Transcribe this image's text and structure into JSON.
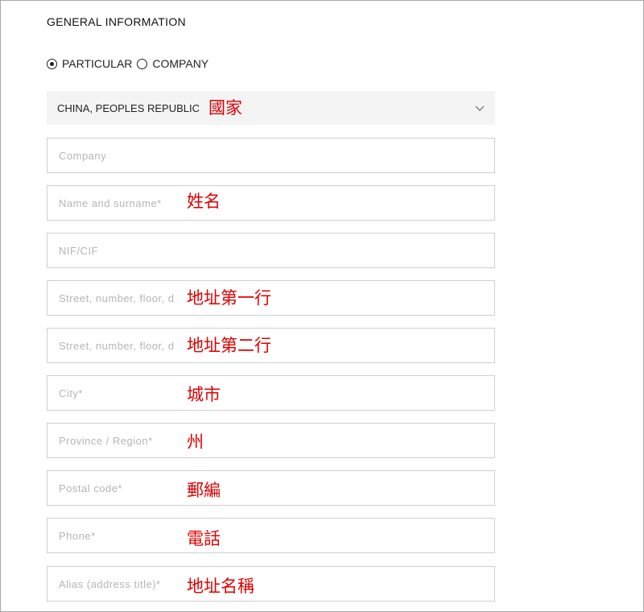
{
  "section_title": "GENERAL INFORMATION",
  "customer_type": {
    "options": [
      {
        "label": "PARTICULAR",
        "selected": true
      },
      {
        "label": "COMPANY",
        "selected": false
      }
    ]
  },
  "country": {
    "value": "CHINA, PEOPLES REPUBLIC",
    "annotation": "國家"
  },
  "fields": {
    "company": {
      "placeholder": "Company"
    },
    "name": {
      "placeholder": "Name and surname*",
      "annotation": "姓名"
    },
    "nif": {
      "placeholder": "NIF/CIF"
    },
    "street1": {
      "placeholder": "Street, number, floor, d",
      "annotation": "地址第一行"
    },
    "street2": {
      "placeholder": "Street, number, floor, d",
      "annotation": "地址第二行"
    },
    "city": {
      "placeholder": "City*",
      "annotation": "城市"
    },
    "province": {
      "placeholder": "Province / Region*",
      "annotation": "州"
    },
    "postal": {
      "placeholder": "Postal code*",
      "annotation": "郵編"
    },
    "phone": {
      "placeholder": "Phone*",
      "annotation": "電話"
    },
    "alias": {
      "placeholder": "Alias (address title)*",
      "annotation": "地址名稱"
    }
  },
  "colors": {
    "annotation": "#e00000",
    "field_border": "#cfcfcf",
    "select_bg": "#f4f4f4",
    "placeholder": "#b5b5b5"
  },
  "icons": {
    "selected_radio": "radio-checked-icon",
    "unselected_radio": "radio-unchecked-icon",
    "dropdown": "chevron-down-icon"
  }
}
